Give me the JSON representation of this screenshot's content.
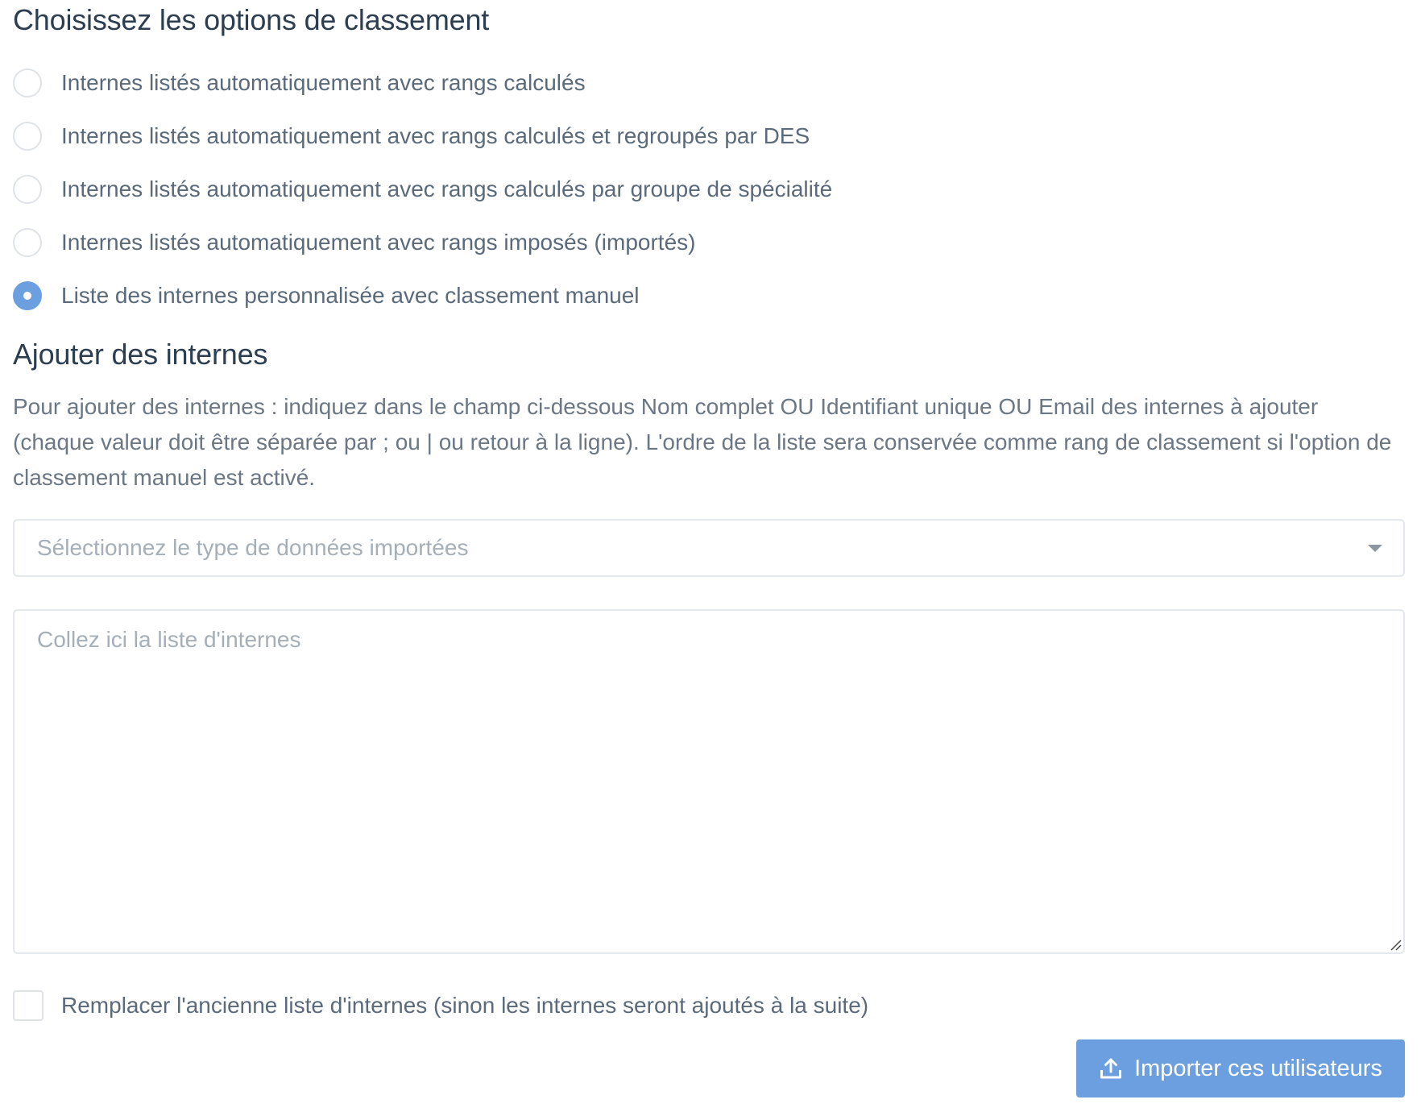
{
  "ranking": {
    "title": "Choisissez les options de classement",
    "options": [
      {
        "label": "Internes listés automatiquement avec rangs calculés",
        "checked": false
      },
      {
        "label": "Internes listés automatiquement avec rangs calculés et regroupés par DES",
        "checked": false
      },
      {
        "label": "Internes listés automatiquement avec rangs calculés par groupe de spécialité",
        "checked": false
      },
      {
        "label": "Internes listés automatiquement avec rangs imposés (importés)",
        "checked": false
      },
      {
        "label": "Liste des internes personnalisée avec classement manuel",
        "checked": true
      }
    ]
  },
  "add_interns": {
    "title": "Ajouter des internes",
    "description": "Pour ajouter des internes : indiquez dans le champ ci-dessous Nom complet OU Identifiant unique OU Email des internes à ajouter (chaque valeur doit être séparée par ; ou | ou retour à la ligne). L'ordre de la liste sera conservée comme rang de classement si l'option de classement manuel est activé.",
    "select_placeholder": "Sélectionnez le type de données importées",
    "textarea_placeholder": "Collez ici la liste d'internes",
    "textarea_value": "",
    "replace_checkbox_label": "Remplacer l'ancienne liste d'internes (sinon les internes seront ajoutés à la suite)",
    "replace_checked": false,
    "import_button_label": "Importer ces utilisateurs"
  },
  "colors": {
    "accent": "#6c9fdf",
    "heading": "#2c3e50",
    "text": "#5a6a7a",
    "placeholder": "#a6afb8",
    "border": "#e4e7eb"
  },
  "icons": {
    "select_caret": "caret-down-icon",
    "button_icon": "upload-icon",
    "textarea_resize": "resize-handle-icon"
  }
}
